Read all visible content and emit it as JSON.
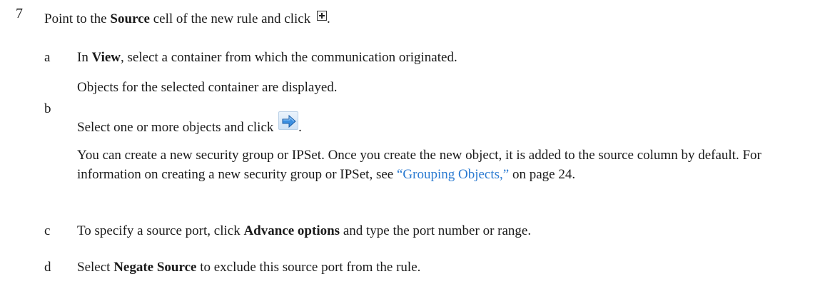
{
  "step": {
    "number": "7",
    "text_before": "Point to the ",
    "bold": "Source",
    "text_after": " cell of the new rule and click",
    "end": "."
  },
  "sub_a": {
    "letter": "a",
    "text_before": "In ",
    "bold": "View",
    "text_after": ", select a container from which the communication originated.",
    "note": "Objects for the selected container are displayed."
  },
  "sub_b": {
    "letter": "b",
    "text": "Select one or more objects and click",
    "end": ".",
    "para_text": "You can create a new security group or IPSet. Once you create the new object, it is added to the source column by default. For information on creating a new security group or IPSet, see ",
    "link_text": "“Grouping Objects,”",
    "para_end": " on page 24."
  },
  "sub_c": {
    "letter": "c",
    "text_before": "To specify a source port, click ",
    "bold": "Advance options",
    "text_after": " and type the port number or range."
  },
  "sub_d": {
    "letter": "d",
    "text_before": "Select ",
    "bold": "Negate Source",
    "text_after": " to exclude this source port from the rule."
  },
  "icons": {
    "add": "plus-box-icon",
    "move_right": "blue-arrow-right-icon"
  },
  "colors": {
    "link": "#2a7ad1",
    "arrow": "#3b8fe0"
  }
}
